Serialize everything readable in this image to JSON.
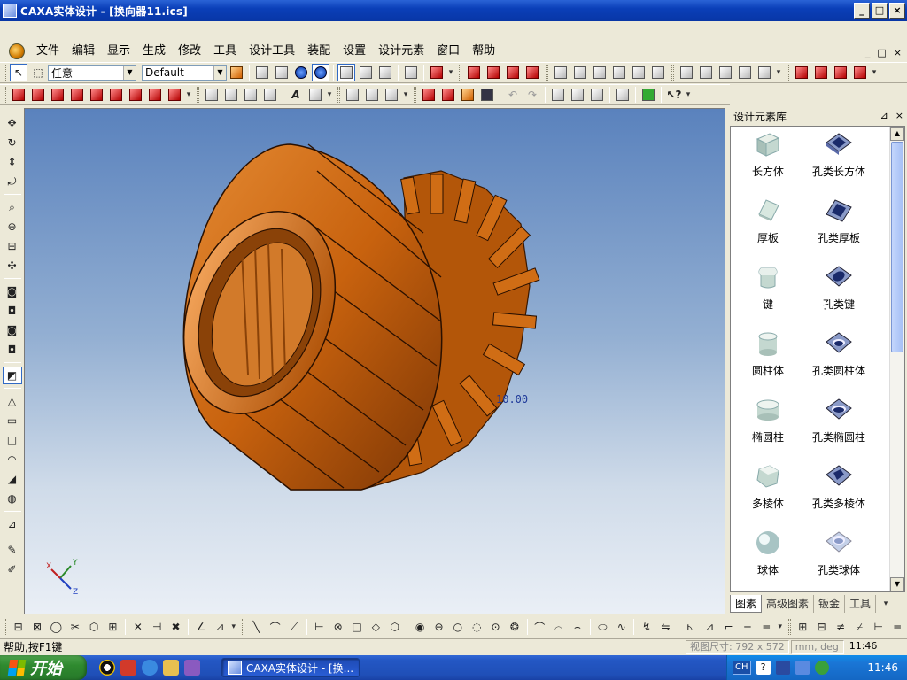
{
  "window": {
    "title": "CAXA实体设计 - [换向器11.ics]",
    "buttons": [
      "_",
      "□",
      "×"
    ]
  },
  "menu": {
    "items": [
      "文件",
      "编辑",
      "显示",
      "生成",
      "修改",
      "工具",
      "设计工具",
      "装配",
      "设置",
      "设计元素",
      "窗口",
      "帮助"
    ],
    "mdi_buttons": [
      "_",
      "□",
      "×"
    ]
  },
  "toolbar1": {
    "select_combo": "任意",
    "style_combo": "Default"
  },
  "viewport": {
    "label": "10.00",
    "axes": {
      "x": "X",
      "y": "Y",
      "z": "Z"
    }
  },
  "library": {
    "title": "设计元素库",
    "items": [
      {
        "label": "长方体",
        "icon": "box-icon"
      },
      {
        "label": "孔类长方体",
        "icon": "box-hole-icon"
      },
      {
        "label": "厚板",
        "icon": "thick-plate-icon"
      },
      {
        "label": "孔类厚板",
        "icon": "thick-plate-hole-icon"
      },
      {
        "label": "键",
        "icon": "key-icon"
      },
      {
        "label": "孔类键",
        "icon": "key-hole-icon"
      },
      {
        "label": "圆柱体",
        "icon": "cylinder-icon"
      },
      {
        "label": "孔类圆柱体",
        "icon": "cylinder-hole-icon"
      },
      {
        "label": "椭圆柱",
        "icon": "elliptic-cylinder-icon"
      },
      {
        "label": "孔类椭圆柱",
        "icon": "elliptic-cylinder-hole-icon"
      },
      {
        "label": "多棱体",
        "icon": "polyhedron-icon"
      },
      {
        "label": "孔类多棱体",
        "icon": "polyhedron-hole-icon"
      },
      {
        "label": "球体",
        "icon": "sphere-icon"
      },
      {
        "label": "孔类球体",
        "icon": "sphere-hole-icon"
      }
    ],
    "tabs": [
      "图素",
      "高级图素",
      "钣金",
      "工具"
    ]
  },
  "status": {
    "help": "帮助,按F1键",
    "view_size": "视图尺寸: 792 x 572",
    "units": "mm, deg",
    "time": "11:46"
  },
  "taskbar": {
    "start": "开始",
    "task_button": "CAXA实体设计 - [换...",
    "lang": "CH",
    "clock": "11:46"
  },
  "colors": {
    "titlebar": "#0a3fb8",
    "model": "#c8620e",
    "viewport_top": "#5a82bd",
    "viewport_bottom": "#eaeff6"
  }
}
